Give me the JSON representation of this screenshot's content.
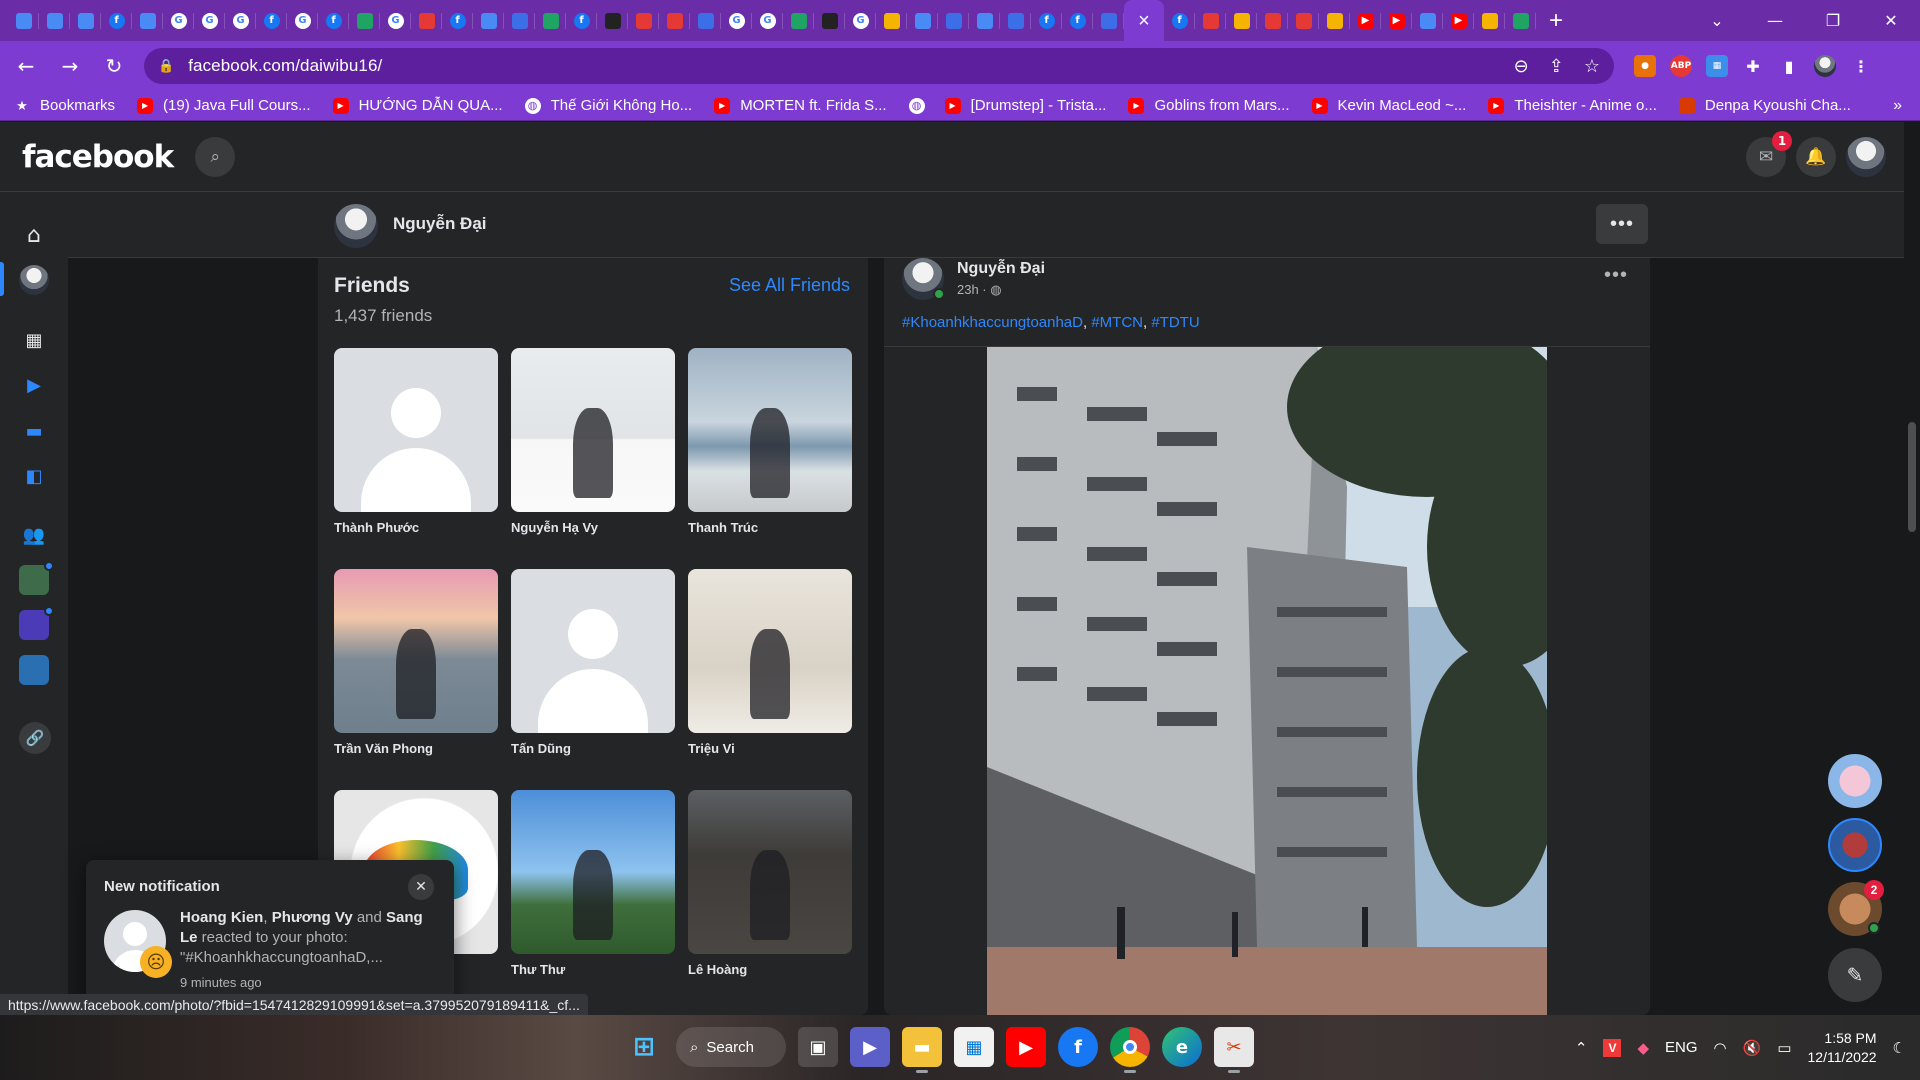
{
  "browser": {
    "tab_favicons": [
      "tr",
      "tr",
      "tr",
      "fb",
      "tr",
      "g",
      "g",
      "g",
      "fb",
      "g",
      "fb",
      "grn",
      "g",
      "red",
      "fb",
      "tr",
      "blu",
      "grn",
      "fb",
      "drk",
      "red",
      "red",
      "blu",
      "g",
      "g",
      "grn",
      "drk",
      "g",
      "org",
      "tr",
      "blu",
      "tr",
      "blu",
      "fb",
      "fb",
      "blu"
    ],
    "tab_favicons_after": [
      "fb",
      "red",
      "org",
      "red",
      "red",
      "org",
      "yt",
      "yt",
      "tr",
      "yt",
      "org",
      "grn"
    ],
    "url": "facebook.com/daiwibu16/",
    "bookmarks": [
      {
        "icon": "star",
        "label": "Bookmarks"
      },
      {
        "icon": "yt",
        "label": "(19) Java Full Cours..."
      },
      {
        "icon": "yt",
        "label": "HƯỚNG DẪN QUA..."
      },
      {
        "icon": "globe",
        "label": "Thế Giới Không Ho..."
      },
      {
        "icon": "yt",
        "label": "MORTEN ft. Frida S..."
      },
      {
        "icon": "globe",
        "label": ""
      },
      {
        "icon": "yt",
        "label": "[Drumstep] - Trista..."
      },
      {
        "icon": "yt",
        "label": "Goblins from Mars..."
      },
      {
        "icon": "yt",
        "label": "Kevin MacLeod ~..."
      },
      {
        "icon": "yt",
        "label": "Theishter - Anime o..."
      },
      {
        "icon": "img",
        "label": "Denpa Kyoushi Cha..."
      }
    ],
    "bookmarks_more": "»",
    "status_url": "https://www.facebook.com/photo/?fbid=1547412829109991&set=a.379952079189411&_cf..."
  },
  "facebook": {
    "logo": "facebook",
    "messenger_badge": "1",
    "profile_name": "Nguyễn Đại",
    "more_label": "•••",
    "friends": {
      "title": "Friends",
      "count": "1,437 friends",
      "see_all": "See All Friends",
      "items": [
        {
          "name": "Thành Phước",
          "photo": "blank"
        },
        {
          "name": "Nguyễn Hạ Vy",
          "photo": "p-vy"
        },
        {
          "name": "Thanh Trúc",
          "photo": "p-truc"
        },
        {
          "name": "Trần Văn Phong",
          "photo": "p-phong"
        },
        {
          "name": "Tấn Dũng",
          "photo": "blank"
        },
        {
          "name": "Triệu Vi",
          "photo": "p-vi"
        },
        {
          "name": "",
          "photo": "p-shoe"
        },
        {
          "name": "Thư Thư",
          "photo": "p-thu"
        },
        {
          "name": "Lê Hoàng",
          "photo": "p-hoang"
        }
      ]
    },
    "post": {
      "author": "Nguyễn Đại",
      "time": "23h ·",
      "more": "•••",
      "tags": [
        "#KhoanhkhaccungtoanhaD",
        "#MTCN",
        "#TDTU"
      ]
    },
    "contacts_badge": "2",
    "notification": {
      "title": "New notification",
      "actors_1": "Hoang Kien",
      "sep_1": ", ",
      "actors_2": "Phương Vy",
      "and": " and ",
      "actors_3": "Sang Le",
      "rest": " reacted to your photo: \"#KhoanhkhaccungtoanhaD,...",
      "ago": "9 minutes ago",
      "close": "✕"
    }
  },
  "taskbar": {
    "search_label": "Search",
    "lang": "ENG",
    "time": "1:58 PM",
    "date": "12/11/2022"
  },
  "colors": {
    "chrome_frame": "#6a2ca7",
    "chrome_toolbar": "#7e3bd1",
    "fb_surface": "#242526",
    "fb_link": "#2d88ff"
  }
}
